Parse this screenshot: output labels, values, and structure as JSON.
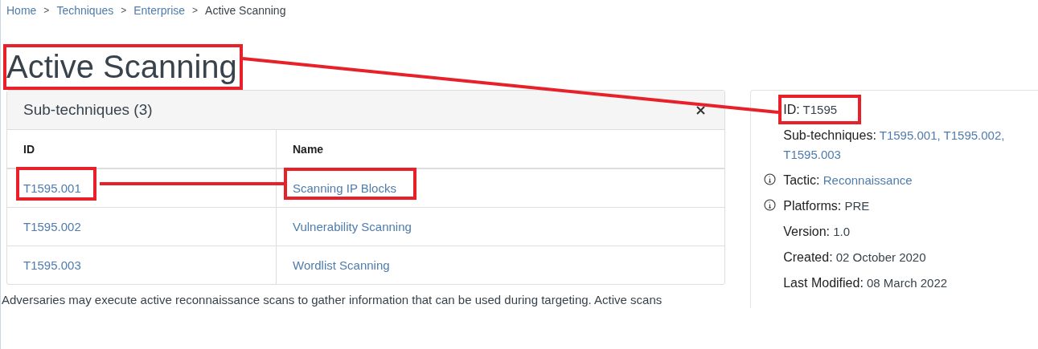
{
  "breadcrumb": [
    {
      "label": "Home",
      "current": false
    },
    {
      "label": "Techniques",
      "current": false
    },
    {
      "label": "Enterprise",
      "current": false
    },
    {
      "label": "Active Scanning",
      "current": true
    }
  ],
  "breadcrumb_separator": ">",
  "title": "Active Scanning",
  "subtechniques": {
    "heading": "Sub-techniques (3)",
    "columns": [
      "ID",
      "Name"
    ],
    "rows": [
      {
        "id": "T1595.001",
        "name": "Scanning IP Blocks"
      },
      {
        "id": "T1595.002",
        "name": "Vulnerability Scanning"
      },
      {
        "id": "T1595.003",
        "name": "Wordlist Scanning"
      }
    ]
  },
  "description": "Adversaries may execute active reconnaissance scans to gather information that can be used during targeting. Active scans",
  "card": [
    {
      "label": "ID:",
      "value": "T1595",
      "kind": "plain",
      "info": false
    },
    {
      "label": "Sub-techniques:",
      "links": [
        "T1595.001,",
        "T1595.002,",
        "T1595.003"
      ],
      "kind": "links",
      "info": false
    },
    {
      "label": "Tactic:",
      "value": "Reconnaissance",
      "kind": "link",
      "info": true
    },
    {
      "label": "Platforms:",
      "value": "PRE",
      "kind": "plain",
      "info": true
    },
    {
      "label": "Version:",
      "value": "1.0",
      "kind": "plain",
      "info": false
    },
    {
      "label": "Created:",
      "value": "02 October 2020",
      "kind": "plain",
      "info": false
    },
    {
      "label": "Last Modified:",
      "value": "08 March 2022",
      "kind": "plain",
      "info": false
    }
  ]
}
